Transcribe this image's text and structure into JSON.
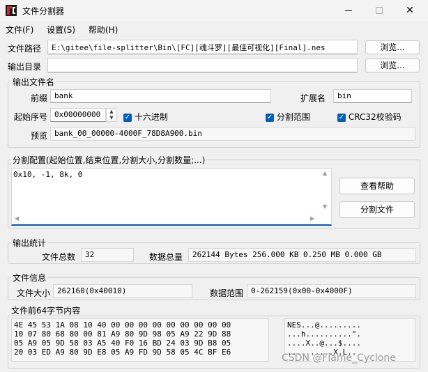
{
  "window": {
    "title": "文件分割器",
    "logo_text": "FC"
  },
  "menu": [
    "文件(F)",
    "设置(S)",
    "帮助(H)"
  ],
  "file_path": {
    "label": "文件路径",
    "value": "E:\\gitee\\file-splitter\\Bin\\[FC][魂斗罗][最佳可视化][Final].nes",
    "browse": "浏览..."
  },
  "output_dir": {
    "label": "输出目录",
    "value": "",
    "browse": "浏览..."
  },
  "output_name": {
    "group": "输出文件名",
    "prefix_label": "前缀",
    "prefix": "bank",
    "ext_label": "扩展名",
    "ext": "bin",
    "start_label": "起始序号",
    "start": "0x00000000",
    "hex_label": "十六进制",
    "range_label": "分割范围",
    "crc_label": "CRC32校验码",
    "preview_label": "预览",
    "preview": "bank_00_00000-4000F_78D8A900.bin"
  },
  "split_config": {
    "group": "分割配置(起始位置,结束位置,分割大小,分割数量;...)",
    "text": "0x10, -1, 8k, 0",
    "help_button": "查看帮助",
    "split_button": "分割文件"
  },
  "stats": {
    "group": "输出统计",
    "total_label": "文件总数",
    "total": "32",
    "size_label": "数据总量",
    "size": "262144 Bytes 256.000 KB 0.250 MB 0.000 GB"
  },
  "info": {
    "group": "文件信息",
    "size_label": "文件大小",
    "size": "262160(0x40010)",
    "range_label": "数据范围",
    "range": "0-262159(0x00-0x4000F)"
  },
  "bytes": {
    "label": "文件前64字节内容",
    "hex": [
      "4E 45 53 1A 08 10 40 00 00 00 00 00 00 00 00 00",
      "10 07 80 68 80 00 81 A9 80 9D 98 05 A9 22 9D 88",
      "05 A9 05 9D 58 03 A5 40 F0 16 BD 24 03 9D B8 05",
      "20 03 ED A9 80 9D E8 05 A9 FD 9D 58 05 4C BF E6"
    ],
    "ascii": [
      "NES...@.........",
      "...h..........\".",
      "....X..@...$....",
      "..........X.L.."
    ]
  },
  "watermark": "CSDN @Flame_Cyclone"
}
